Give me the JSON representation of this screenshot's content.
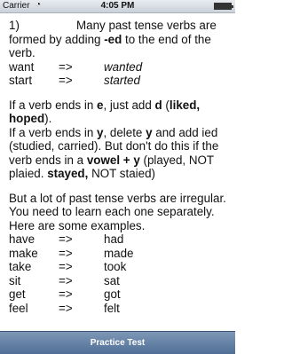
{
  "status": {
    "carrier": "Carrier",
    "time": "4:05 PM"
  },
  "lesson": {
    "intro_num": "1)",
    "intro_text_1": "Many past tense verbs are formed by adding ",
    "intro_suffix": "-ed",
    "intro_text_2": " to the end of the verb.",
    "regular": [
      {
        "base": "want",
        "arrow": "=>",
        "past": "wanted"
      },
      {
        "base": "start",
        "arrow": "=>",
        "past": "started"
      }
    ],
    "rule_e_1": "If a verb ends in ",
    "rule_e_letter": "e",
    "rule_e_2": ", just add ",
    "rule_e_add": "d",
    "rule_e_3": " (",
    "rule_e_examples": "liked, hoped",
    "rule_e_4": ").",
    "rule_y_1": "If a verb ends in ",
    "rule_y_letter": "y",
    "rule_y_2": ", delete ",
    "rule_y_delete": "y",
    "rule_y_3": " and add ied (studied, carried). But don't do this if the verb ends in a ",
    "rule_y_vowel": "vowel + y",
    "rule_y_4": " (played, NOT plaied. ",
    "rule_y_stayed": "stayed,",
    "rule_y_5": " NOT staied)",
    "irregular_intro": "But a lot of past tense verbs are irregular. You need to learn each one separately. Here are some examples.",
    "irregular": [
      {
        "base": "have",
        "arrow": "=>",
        "past": "had"
      },
      {
        "base": "make",
        "arrow": "=>",
        "past": "made"
      },
      {
        "base": "take",
        "arrow": "=>",
        "past": "took"
      },
      {
        "base": "sit",
        "arrow": "=>",
        "past": "sat"
      },
      {
        "base": "get",
        "arrow": "=>",
        "past": "got"
      },
      {
        "base": "feel",
        "arrow": "=>",
        "past": "felt"
      }
    ]
  },
  "toolbar": {
    "practice_label": "Practice Test"
  },
  "colors": {
    "toolbar": "#5f7ea5",
    "statusbar": "#d5dbe2"
  }
}
